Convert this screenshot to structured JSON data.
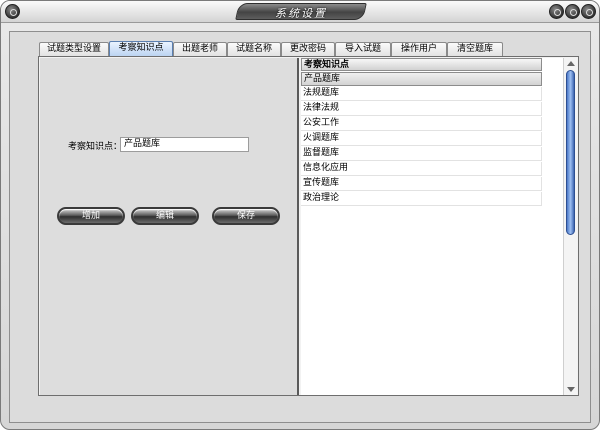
{
  "window": {
    "title": "系统设置"
  },
  "tabs": [
    {
      "label": "试题类型设置"
    },
    {
      "label": "考察知识点"
    },
    {
      "label": "出题老师"
    },
    {
      "label": "试题名称"
    },
    {
      "label": "更改密码"
    },
    {
      "label": "导入试题"
    },
    {
      "label": "操作用户"
    },
    {
      "label": "清空题库"
    }
  ],
  "active_tab": "考察知识点",
  "form": {
    "label": "考察知识点：",
    "value": "产品题库"
  },
  "buttons": {
    "add": "增加",
    "edit": "编辑",
    "save": "保存"
  },
  "list": {
    "header": "考察知识点",
    "items": [
      "产品题库",
      "法规题库",
      "法律法规",
      "公安工作",
      "火调题库",
      "监督题库",
      "信息化应用",
      "宣传题库",
      "政治理论"
    ],
    "selected_index": 0
  },
  "scrollbar": {
    "thumb_position": 0.0,
    "thumb_size": 0.5
  }
}
